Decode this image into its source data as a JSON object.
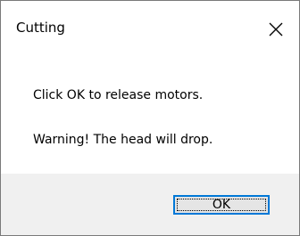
{
  "window": {
    "title": "Cutting",
    "close_icon": "close-icon"
  },
  "message": {
    "line1": "Click OK to release motors.",
    "line2": "Warning! The head will drop."
  },
  "buttons": {
    "ok_label": "OK"
  },
  "colors": {
    "footer_bg": "#f0f0f0",
    "focus_border": "#0078d7",
    "button_bg": "#e5e5e5"
  }
}
